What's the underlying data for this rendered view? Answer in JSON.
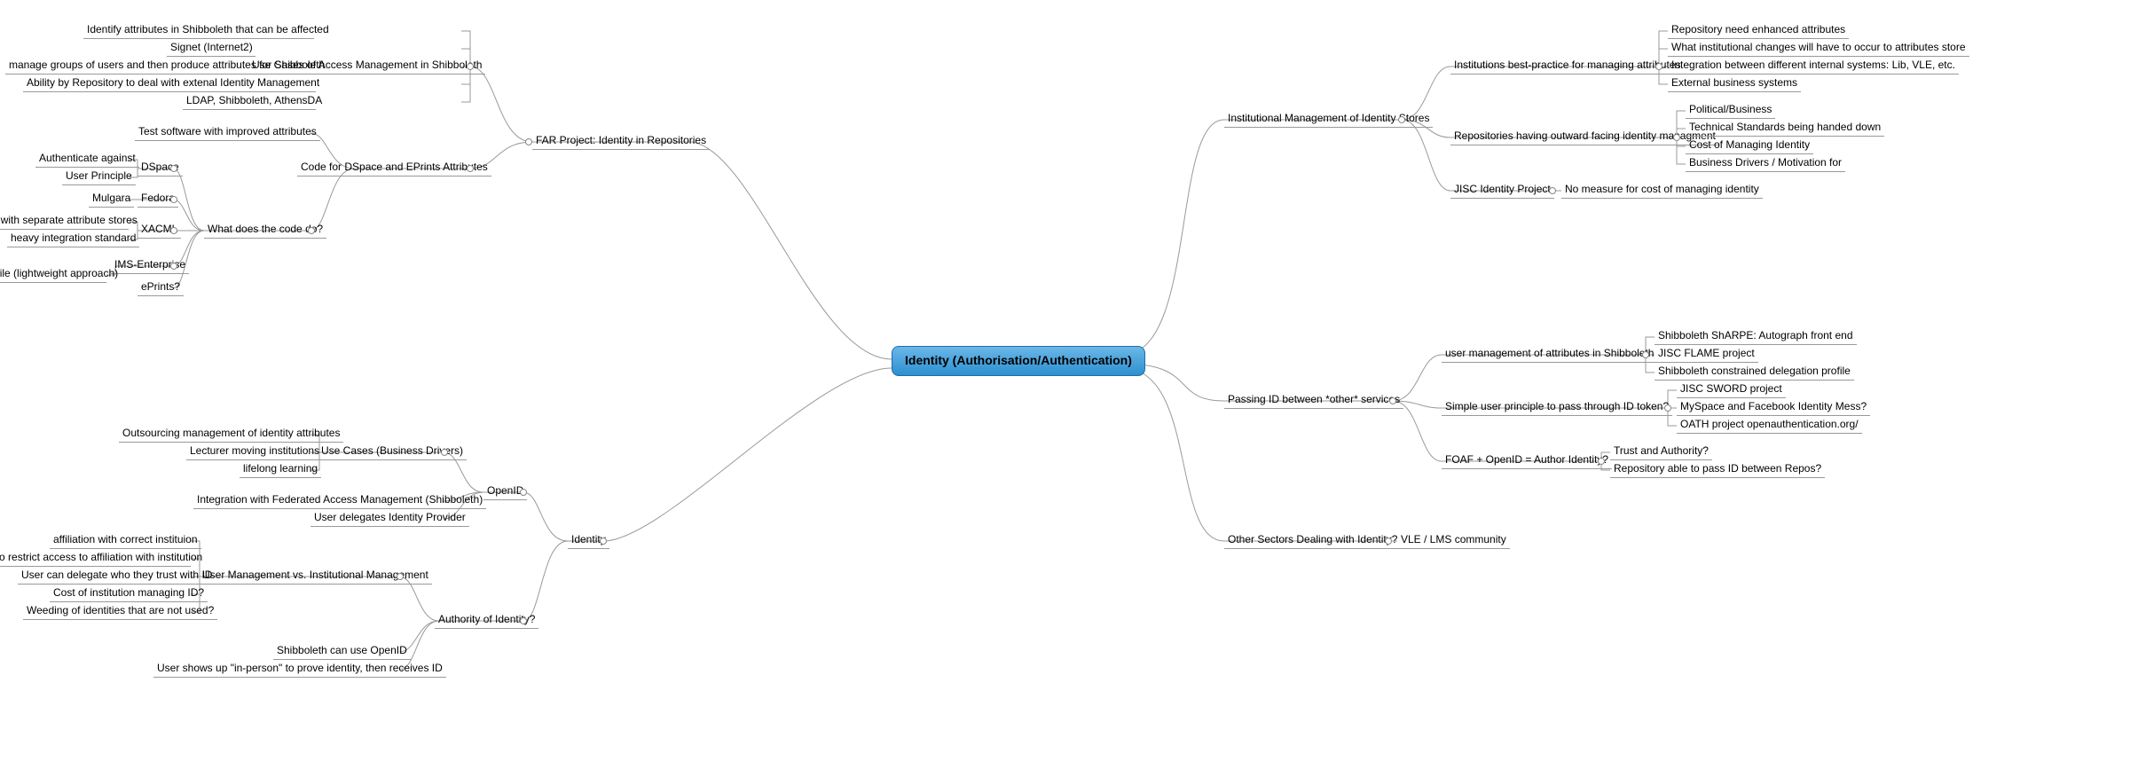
{
  "root": "Identity (Authorisation/Authentication)",
  "branches": {
    "far": {
      "label": "FAR Project: Identity in Repositories",
      "children": {
        "usecases": {
          "label": "Use Cases of Access Management in Shibboleth",
          "leaves": [
            "Identify attributes in Shibboleth that can be affected",
            "Signet (Internet2)",
            "manage groups of users and then produce attributes for Shibboleth",
            "Ability by Repository to deal with extenal Identity Management",
            "LDAP, Shibboleth, AthensDA"
          ]
        },
        "code": {
          "label": "Code for DSpace and EPrints Attributes",
          "test": "Test software with improved attributes",
          "what": {
            "label": "What does the code do?",
            "dspace": {
              "label": "DSpace",
              "leaves": [
                "Authenticate against",
                "User Principle"
              ]
            },
            "fedora": {
              "label": "Fedora",
              "leaves": [
                "Mulgara"
              ]
            },
            "xacml": {
              "label": "XACML",
              "leaves": [
                "integrating systems with separate attribute stores",
                "heavy integration standard"
              ]
            },
            "ims": {
              "label": "IMS-Enterprise",
              "leaves": [
                "ApplicationProfile (lightweight approach)"
              ]
            },
            "eprints": "ePrints?"
          }
        }
      }
    },
    "identity": {
      "label": "Identity",
      "openid": {
        "label": "OpenID",
        "usecases": {
          "label": "Use Cases (Business Drivers)",
          "leaves": [
            "Outsourcing management of identity attributes",
            "Lecturer moving institutions",
            "lifelong learning"
          ]
        },
        "integration": "Integration with Federated Access Management (Shibboleth)",
        "delegates": "User delegates Identity Provider"
      },
      "authority": {
        "label": "Authority of Identity?",
        "usermgmt": {
          "label": "User Management vs. Institutional Management",
          "leaves": [
            "affiliation with correct instituion",
            "right to restrict access to affiliation with institution",
            "User can delegate who they trust with ID",
            "Cost of institution managing ID?",
            "Weeding of identities that are not used?"
          ]
        },
        "leaves": [
          "Shibboleth can use OpenID",
          "User shows up \"in-person\" to prove identity, then receives ID"
        ]
      }
    },
    "institutional": {
      "label": "Institutional Management of Identity Stores",
      "best": {
        "label": "Institutions best-practice for managing attributes",
        "leaves": [
          "Repository need enhanced attributes",
          "What institutional changes will have to occur to attributes store",
          "Integration between different internal systems: Lib, VLE, etc.",
          "External business systems"
        ]
      },
      "outward": {
        "label": "Repositories having outward facing identity managment",
        "leaves": [
          "Political/Business",
          "Technical Standards being handed down",
          "Cost of Managing Identity",
          "Business Drivers / Motivation for"
        ]
      },
      "jisc": {
        "label": "JISC Identity Project",
        "child": "No measure for cost of managing identity"
      }
    },
    "passing": {
      "label": "Passing ID between *other* services",
      "shib": {
        "label": "user management of attributes in Shibboleth",
        "leaves": [
          "Shibboleth ShARPE: Autograph front end",
          "JISC FLAME project",
          "Shibboleth constrained delegation profile"
        ]
      },
      "simple": {
        "label": "Simple user principle to pass through ID token?",
        "leaves": [
          "JISC SWORD project",
          "MySpace and Facebook Identity Mess?",
          "OATH project openauthentication.org/"
        ]
      },
      "foaf": {
        "label": "FOAF + OpenID = Author Identity?",
        "leaves": [
          "Trust and Authority?",
          "Repository able to pass ID between Repos?"
        ]
      }
    },
    "other": {
      "label": "Other Sectors Dealing with Identity?",
      "child": "VLE / LMS community"
    }
  }
}
